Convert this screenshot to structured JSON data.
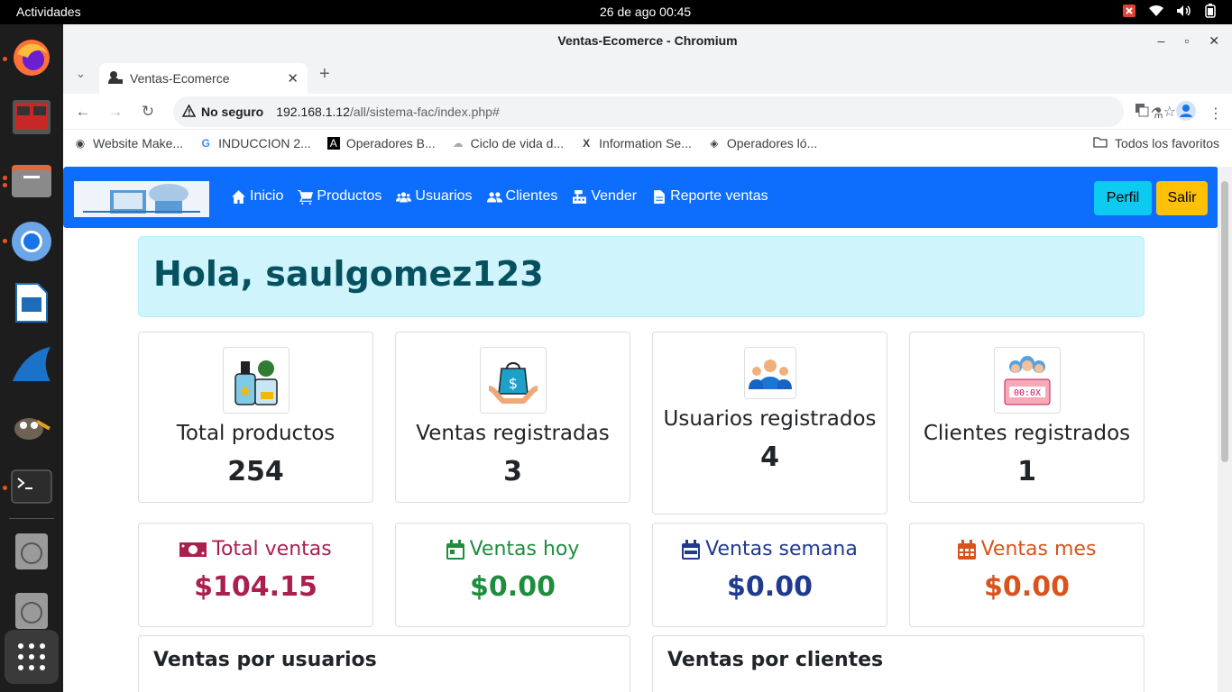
{
  "system": {
    "activities_label": "Actividades",
    "clock": "26 de ago  00:45"
  },
  "browser": {
    "window_title": "Ventas-Ecomerce - Chromium",
    "tab_title": "Ventas-Ecomerce",
    "security_label": "No seguro",
    "url_host": "192.168.1.12",
    "url_path": "/all/sistema-fac/index.php#",
    "bookmarks": [
      "Website Make...",
      "INDUCCION 2...",
      "Operadores B...",
      "Ciclo de vida d...",
      "Information Se...",
      "Operadores ló..."
    ],
    "all_bookmarks_label": "Todos los favoritos"
  },
  "navbar": {
    "links": [
      "Inicio",
      "Productos",
      "Usuarios",
      "Clientes",
      "Vender",
      "Reporte ventas"
    ],
    "perfil_label": "Perfil",
    "salir_label": "Salir",
    "brand_color": "#0d6efd"
  },
  "greeting": "Hola, saulgomez123",
  "stats": [
    {
      "label": "Total productos",
      "value": "254",
      "icon": "cosmetics-products-icon"
    },
    {
      "label": "Ventas registradas",
      "value": "3",
      "icon": "shopping-bag-dollar-icon"
    },
    {
      "label": "Usuarios registrados",
      "value": "4",
      "icon": "users-group-icon"
    },
    {
      "label": "Clientes registrados",
      "value": "1",
      "icon": "clients-counter-icon"
    }
  ],
  "money": [
    {
      "label": "Total ventas",
      "value": "$104.15",
      "color": "#ab1f4f",
      "icon": "money-bill-icon"
    },
    {
      "label": "Ventas hoy",
      "value": "$0.00",
      "color": "#1e8e3e",
      "icon": "calendar-day-icon"
    },
    {
      "label": "Ventas semana",
      "value": "$0.00",
      "color": "#1f3a8f",
      "icon": "calendar-week-icon"
    },
    {
      "label": "Ventas mes",
      "value": "$0.00",
      "color": "#d9531e",
      "icon": "calendar-month-icon"
    }
  ],
  "sections": {
    "users": "Ventas por usuarios",
    "clients": "Ventas por clientes"
  }
}
